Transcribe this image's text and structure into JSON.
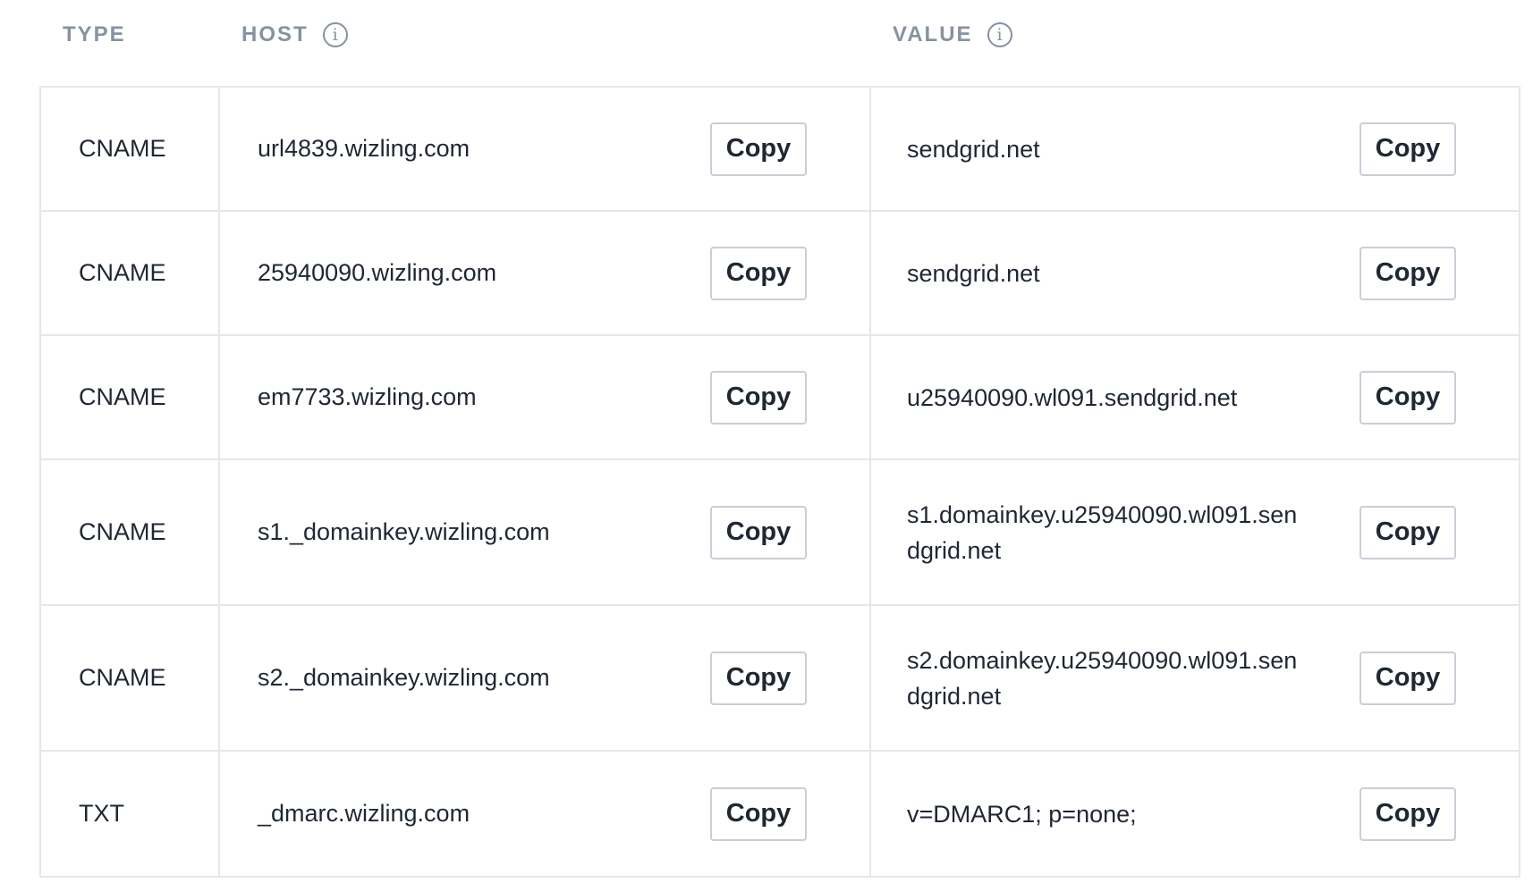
{
  "header": {
    "type_label": "TYPE",
    "host_label": "HOST",
    "value_label": "VALUE",
    "info_icon_glyph": "i"
  },
  "records": [
    {
      "type": "CNAME",
      "host": "url4839.wizling.com",
      "value": "sendgrid.net",
      "copy_label": "Copy"
    },
    {
      "type": "CNAME",
      "host": "25940090.wizling.com",
      "value": "sendgrid.net",
      "copy_label": "Copy"
    },
    {
      "type": "CNAME",
      "host": "em7733.wizling.com",
      "value": "u25940090.wl091.sendgrid.net",
      "copy_label": "Copy"
    },
    {
      "type": "CNAME",
      "host": "s1._domainkey.wizling.com",
      "value": "s1.domainkey.u25940090.wl091.sendgrid.net",
      "copy_label": "Copy"
    },
    {
      "type": "CNAME",
      "host": "s2._domainkey.wizling.com",
      "value": "s2.domainkey.u25940090.wl091.sendgrid.net",
      "copy_label": "Copy"
    },
    {
      "type": "TXT",
      "host": "_dmarc.wizling.com",
      "value": "v=DMARC1; p=none;",
      "copy_label": "Copy"
    }
  ],
  "colors": {
    "header_text": "#8792a2",
    "body_text": "#1f2733",
    "border": "#e3e7ec",
    "button_border": "#c9ced6"
  }
}
